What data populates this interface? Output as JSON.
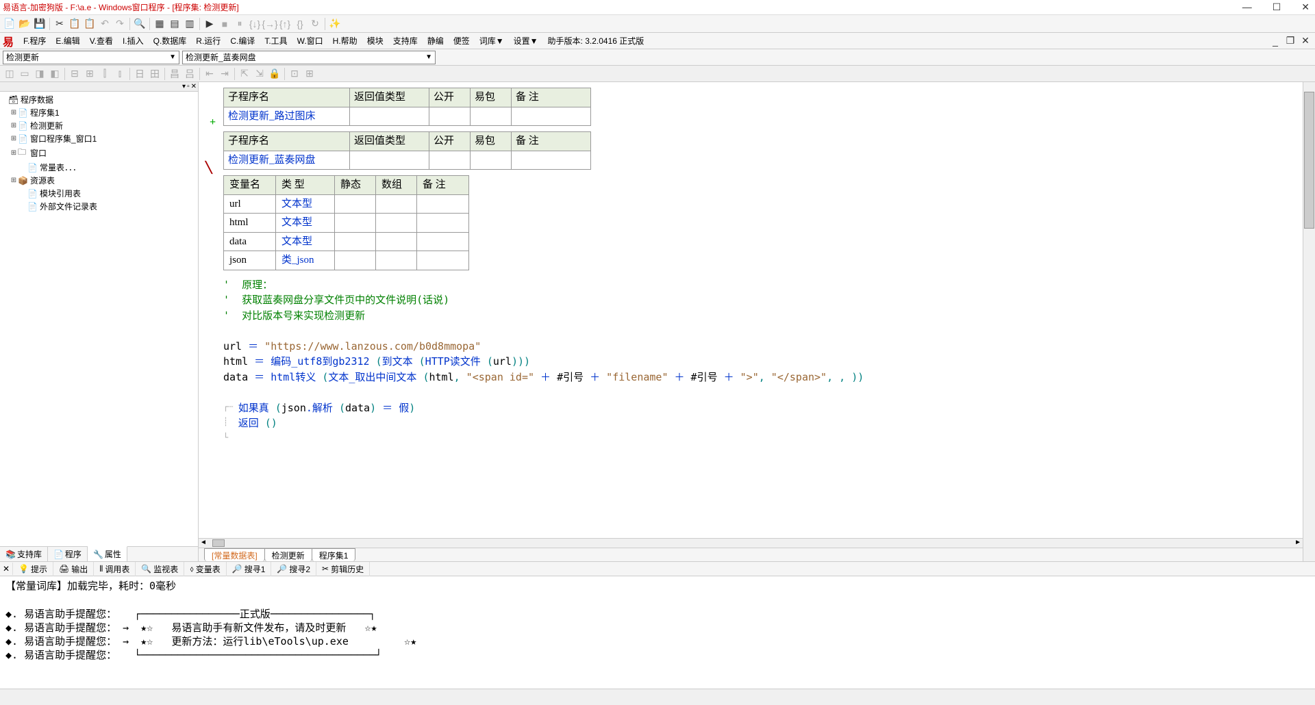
{
  "title": "易语言-加密狗版 - F:\\a.e - Windows窗口程序 - [程序集: 检测更新]",
  "win_btns": {
    "min": "—",
    "max": "☐",
    "close": "✕"
  },
  "menu": [
    "F.程序",
    "E.编辑",
    "V.查看",
    "I.插入",
    "Q.数据库",
    "R.运行",
    "C.编译",
    "T.工具",
    "W.窗口",
    "H.帮助",
    "模块",
    "支持库",
    "静编",
    "便签",
    "词库▼",
    "设置▼",
    "助手版本: 3.2.0416 正式版"
  ],
  "combo1": "检测更新",
  "combo2": "检测更新_蓝奏网盘",
  "tree_root": "程序数据",
  "tree_items": [
    {
      "ind": 1,
      "plus": "⊞",
      "icon": "📄",
      "label": "程序集1"
    },
    {
      "ind": 1,
      "plus": "⊞",
      "icon": "📄",
      "label": "检测更新"
    },
    {
      "ind": 1,
      "plus": "⊞",
      "icon": "📄",
      "label": "窗口程序集_窗口1"
    },
    {
      "ind": 1,
      "plus": "⊞",
      "icon": "🗀",
      "label": "窗口"
    },
    {
      "ind": 2,
      "plus": "",
      "icon": "📄",
      "label": "常量表．．．"
    },
    {
      "ind": 1,
      "plus": "⊞",
      "icon": "📦",
      "label": "资源表"
    },
    {
      "ind": 2,
      "plus": "",
      "icon": "📄",
      "label": "模块引用表"
    },
    {
      "ind": 2,
      "plus": "",
      "icon": "📄",
      "label": "外部文件记录表"
    }
  ],
  "left_tabs": [
    {
      "icon": "📚",
      "label": "支持库"
    },
    {
      "icon": "📄",
      "label": "程序"
    },
    {
      "icon": "🔧",
      "label": "属性",
      "active": true
    }
  ],
  "sub_header": [
    "子程序名",
    "返回值类型",
    "公开",
    "易包",
    "备  注"
  ],
  "sub1_name": "检测更新_路过图床",
  "sub2_name": "检测更新_蓝奏网盘",
  "var_header": [
    "变量名",
    "类  型",
    "静态",
    "数组",
    "备  注"
  ],
  "vars": [
    {
      "name": "url",
      "type": "文本型"
    },
    {
      "name": "html",
      "type": "文本型"
    },
    {
      "name": "data",
      "type": "文本型"
    },
    {
      "name": "json",
      "type": "类_json"
    }
  ],
  "comments": [
    "'  原理：",
    "'  获取蓝奏网盘分享文件页中的文件说明(话说)",
    "'  对比版本号来实现检测更新"
  ],
  "code": {
    "l1a": "url ",
    "l1b": "＝",
    "l1c": " \"https://www.lanzous.com/b0d8mmopa\"",
    "l2a": "html ",
    "l2b": "＝",
    "l2c": " 编码_utf8到gb2312 ",
    "l2d": "(",
    "l2e": "到文本 ",
    "l2f": "(",
    "l2g": "HTTP读文件 ",
    "l2h": "(",
    "l2i": "url",
    "l2j": ")))",
    "l3a": "data ",
    "l3b": "＝",
    "l3c": " html转义 ",
    "l3d": "(",
    "l3e": "文本_取出中间文本 ",
    "l3f": "(",
    "l3g": "html",
    "l3h": ", ",
    "l3i": "\"<span id=\"",
    "l3j": " ＋ ",
    "l3k": "#引号",
    "l3l": " ＋ ",
    "l3m": "\"filename\"",
    "l3n": " ＋ ",
    "l3o": "#引号",
    "l3p": " ＋ ",
    "l3q": "\">\"",
    "l3r": ", ",
    "l3s": "\"</span>\"",
    "l3t": ", , ",
    "l3u": "))",
    "l4a": "如果真 ",
    "l4b": "(",
    "l4c": "json",
    "l4d": ".",
    "l4e": "解析 ",
    "l4f": "(",
    "l4g": "data",
    "l4h": ")",
    "l4i": " ＝ ",
    "l4j": "假",
    "l4k": ")",
    "l5a": "返回 ",
    "l5b": "()"
  },
  "editor_tabs": [
    {
      "label": "[常量数据表]",
      "cls": "orange"
    },
    {
      "label": "检测更新",
      "cls": "active"
    },
    {
      "label": "程序集1",
      "cls": ""
    }
  ],
  "bottom_tabs": [
    {
      "icon": "✕",
      "label": ""
    },
    {
      "icon": "💡",
      "label": "提示"
    },
    {
      "icon": "🖨",
      "label": "输出"
    },
    {
      "icon": "⫴",
      "label": "调用表"
    },
    {
      "icon": "🔍",
      "label": "监视表"
    },
    {
      "icon": "⬨",
      "label": "变量表"
    },
    {
      "icon": "🔎",
      "label": "搜寻1"
    },
    {
      "icon": "🔎",
      "label": "搜寻2"
    },
    {
      "icon": "✂",
      "label": "剪辑历史"
    }
  ],
  "console": {
    "l1": "【常量词库】加载完毕，耗时：0毫秒",
    "reminder": "易语言助手提醒您：",
    "arrow": "→",
    "star": "★☆",
    "rstar": "☆★",
    "header": "正式版",
    "c1": "易语言助手有新文件发布，请及时更新",
    "c2": "更新方法：运行lib\\eTools\\up.exe"
  }
}
